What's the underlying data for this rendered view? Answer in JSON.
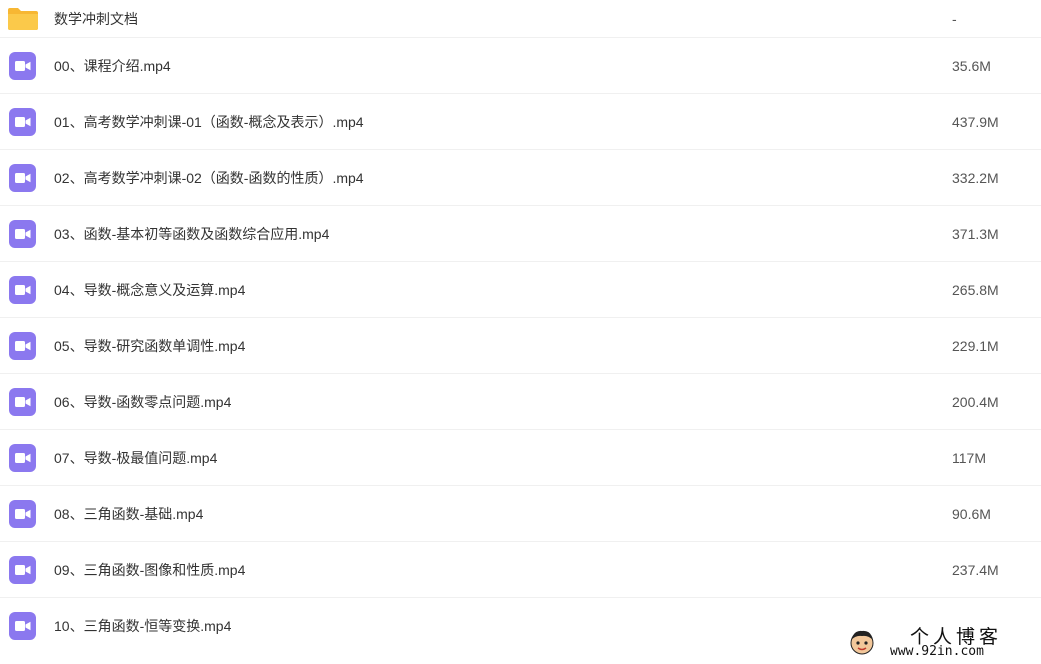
{
  "files": [
    {
      "icon": "folder-icon",
      "name": "数学冲刺文档",
      "size": "-"
    },
    {
      "icon": "video-file-icon",
      "name": "00、课程介绍.mp4",
      "size": "35.6M"
    },
    {
      "icon": "video-file-icon",
      "name": "01、高考数学冲刺课-01（函数-概念及表示）.mp4",
      "size": "437.9M"
    },
    {
      "icon": "video-file-icon",
      "name": "02、高考数学冲刺课-02（函数-函数的性质）.mp4",
      "size": "332.2M"
    },
    {
      "icon": "video-file-icon",
      "name": "03、函数-基本初等函数及函数综合应用.mp4",
      "size": "371.3M"
    },
    {
      "icon": "video-file-icon",
      "name": "04、导数-概念意义及运算.mp4",
      "size": "265.8M"
    },
    {
      "icon": "video-file-icon",
      "name": "05、导数-研究函数单调性.mp4",
      "size": "229.1M"
    },
    {
      "icon": "video-file-icon",
      "name": "06、导数-函数零点问题.mp4",
      "size": "200.4M"
    },
    {
      "icon": "video-file-icon",
      "name": "07、导数-极最值问题.mp4",
      "size": "117M"
    },
    {
      "icon": "video-file-icon",
      "name": "08、三角函数-基础.mp4",
      "size": "90.6M"
    },
    {
      "icon": "video-file-icon",
      "name": "09、三角函数-图像和性质.mp4",
      "size": "237.4M"
    },
    {
      "icon": "video-file-icon",
      "name": "10、三角函数-恒等变换.mp4",
      "size": ""
    }
  ],
  "watermark": {
    "title": "个人博客",
    "url": "www.92in.com"
  },
  "colors": {
    "video_icon": "#8b78ef",
    "folder_icon": "#fbc94a",
    "row_divider": "#f0f0f0"
  }
}
